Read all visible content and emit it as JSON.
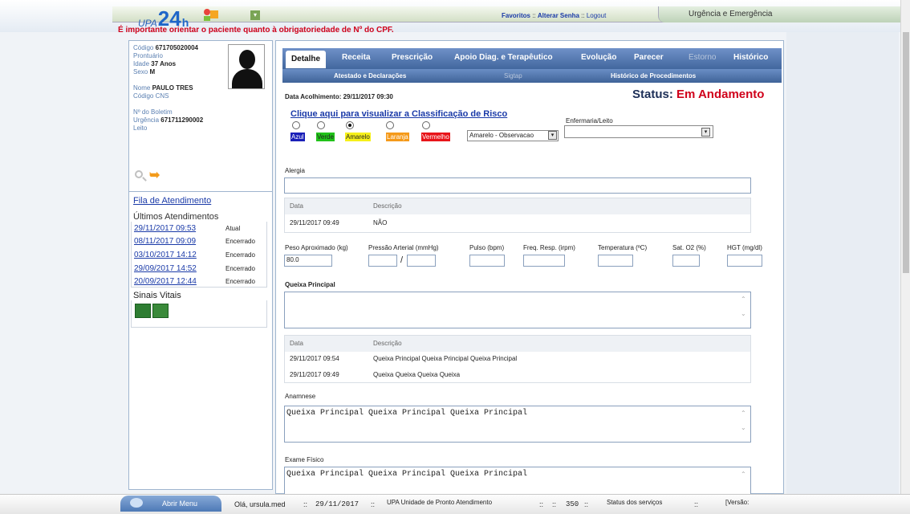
{
  "header": {
    "logo_prefix": "UPA",
    "logo_number": "24",
    "logo_suffix": "h",
    "favoritos": "Favoritos",
    "sep1": " :: ",
    "alterar_senha": "Alterar Senha",
    "sep2": " :: ",
    "logout": "Logout",
    "urgencia": "Urgência e Emergência",
    "warning": "É importante orientar o paciente quanto à obrigatoriedade de Nº do CPF."
  },
  "patient": {
    "codigo_label": "Código",
    "codigo": "671705020004",
    "prontuario_label": "Prontuário",
    "idade_label": "Idade",
    "idade": "37 Anos",
    "sexo_label": "Sexo",
    "sexo": "M",
    "nome_label": "Nome",
    "nome": "PAULO TRES",
    "cns_label": "Código CNS",
    "boletim_label": "Nº do Boletim",
    "urgencia_label": "Urgência",
    "urgencia": "671711290002",
    "leito_label": "Leito"
  },
  "sidebar": {
    "fila": "Fila de Atendimento",
    "ultimos": "Últimos Atendimentos",
    "sinais": "Sinais Vitais",
    "atendimentos": [
      {
        "date": "29/11/2017 09:53",
        "status": "Atual"
      },
      {
        "date": "08/11/2017 09:09",
        "status": "Encerrado"
      },
      {
        "date": "03/10/2017 14:12",
        "status": "Encerrado"
      },
      {
        "date": "29/09/2017 14:52",
        "status": "Encerrado"
      },
      {
        "date": "20/09/2017 12:44",
        "status": "Encerrado"
      }
    ]
  },
  "tabs": {
    "row1": [
      "Detalhe",
      "Receita",
      "Prescrição",
      "Apoio Diag. e Terapêutico",
      "Evolução",
      "Parecer",
      "Estorno",
      "Histórico"
    ],
    "row2": [
      "Atestado e Declarações",
      "Sigtap",
      "Histórico de Procedimentos"
    ]
  },
  "detail": {
    "data_acolhimento": "Data Acolhimento: 29/11/2017 09:30",
    "status_label": "Status:",
    "status_value": "Em Andamento",
    "classif_link": "Clique aqui para visualizar a Classificação de Risco",
    "risk": [
      {
        "label": "Azul",
        "color": "#1a20b8"
      },
      {
        "label": "Verde",
        "color": "#21c21a"
      },
      {
        "label": "Amarelo",
        "color": "#f6f01a"
      },
      {
        "label": "Laranja",
        "color": "#f59a1a"
      },
      {
        "label": "Vermelho",
        "color": "#e8151a"
      }
    ],
    "risk_selected": "Amarelo - Observacao",
    "enfermaria_label": "Enfermaria/Leito",
    "alergia_label": "Alergia",
    "col_data": "Data",
    "col_desc": "Descrição",
    "alergia_rows": [
      {
        "data": "29/11/2017 09:49",
        "desc": "NÃO"
      }
    ],
    "vitals": {
      "peso": "Peso Aproximado (kg)",
      "peso_value": "80.0",
      "pressao": "Pressão Arterial (mmHg)",
      "pulso": "Pulso (bpm)",
      "freq": "Freq. Resp. (irpm)",
      "temp": "Temperatura (ºC)",
      "sat": "Sat. O2 (%)",
      "hgt": "HGT (mg/dl)"
    },
    "queixa_label": "Queixa Principal",
    "queixa_rows": [
      {
        "data": "29/11/2017 09:54",
        "desc": "Queixa Principal Queixa Principal Queixa Principal"
      },
      {
        "data": "29/11/2017 09:49",
        "desc": "Queixa Queixa Queixa Queixa"
      }
    ],
    "anamnese_label": "Anamnese",
    "anamnese_text": "Queixa Principal Queixa Principal Queixa Principal",
    "exame_label": "Exame Físico",
    "exame_text": "Queixa Principal Queixa Principal Queixa Principal"
  },
  "footer": {
    "menu": "Abrir Menu",
    "ola": "Olá, ursula.med",
    "date": "29/11/2017",
    "sep": "::",
    "unidade": "UPA Unidade de Pronto Atendimento",
    "num": "350",
    "servicos": "Status dos serviços",
    "versao": "[Versão:"
  }
}
